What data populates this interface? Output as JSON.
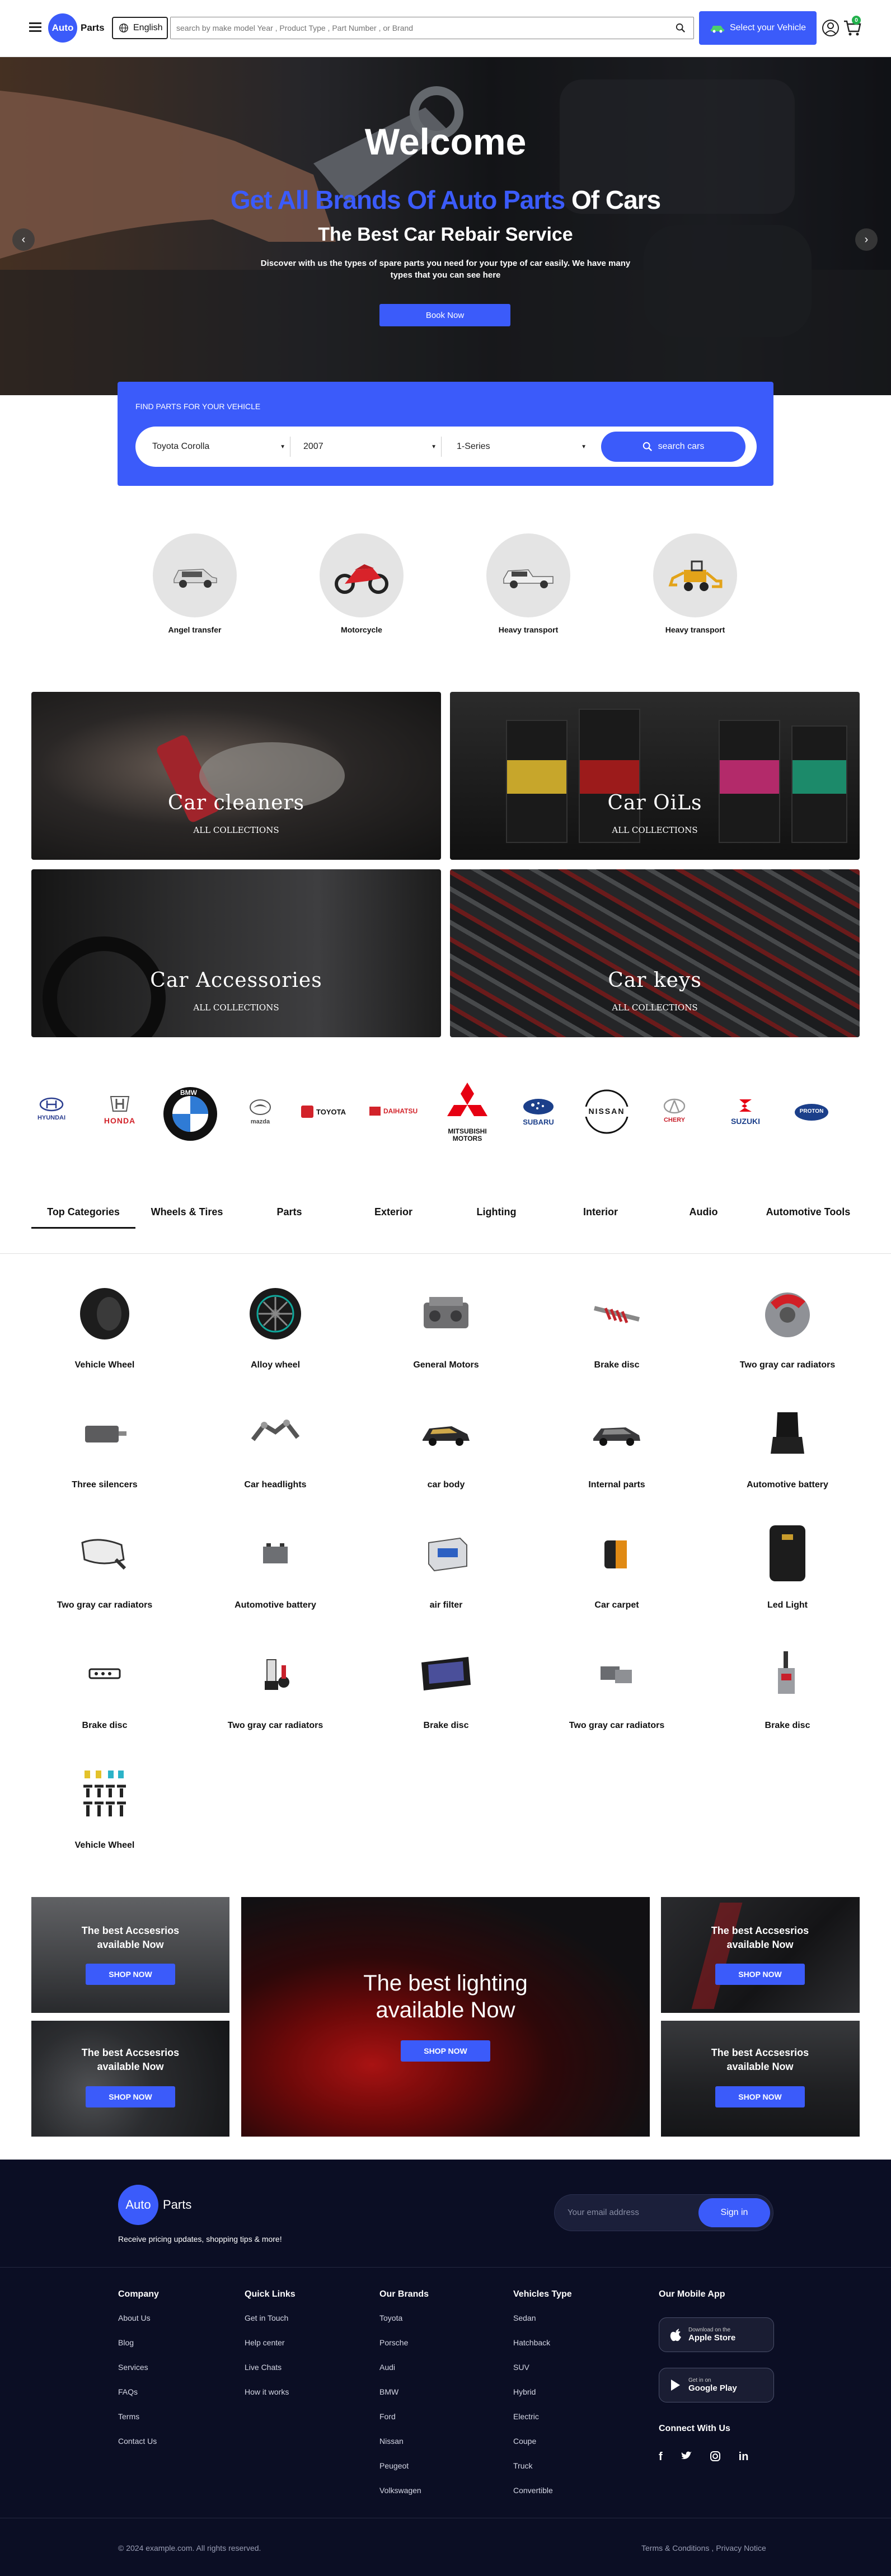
{
  "header": {
    "menu_icon": "hamburger-icon",
    "logo": {
      "part1": "Auto",
      "part2": "Parts"
    },
    "language": "English",
    "search_placeholder": "search by make model Year , Product Type , Part Number , or Brand",
    "select_vehicle": "Select your Vehicle",
    "cart_count": "0"
  },
  "hero": {
    "welcome": "Welcome",
    "headline_blue": "Get All Brands Of Auto Parts",
    "headline_white": "Of Cars",
    "subheading": "The Best Car Rebair Service",
    "description": "Discover with us the types of spare parts you need for your type of car easily. We have many types that you can see here",
    "button": "Book Now",
    "colors": {
      "accent": "#3b5bfa"
    }
  },
  "finder": {
    "title": "FIND PARTS FOR YOUR VEHICLE",
    "model": "Toyota Corolla",
    "year": "2007",
    "series": "1-Series",
    "button": "search cars"
  },
  "vehicle_types": [
    {
      "label": "Angel transfer",
      "icon": "suv-icon"
    },
    {
      "label": "Motorcycle",
      "icon": "motorcycle-icon"
    },
    {
      "label": "Heavy transport",
      "icon": "pickup-truck-icon"
    },
    {
      "label": "Heavy transport",
      "icon": "loader-icon"
    }
  ],
  "collections": [
    {
      "title": "Car cleaners",
      "sub": "ALL COLLECTIONS"
    },
    {
      "title": "Car OiLs",
      "sub": "ALL COLLECTIONS"
    },
    {
      "title": "Car Accessories",
      "sub": "ALL COLLECTIONS"
    },
    {
      "title": "Car keys",
      "sub": "ALL COLLECTIONS"
    }
  ],
  "brands": [
    "HYUNDAI",
    "HONDA",
    "BMW",
    "mazda",
    "TOYOTA",
    "DAIHATSU",
    "MITSUBISHI MOTORS",
    "SUBARU",
    "NISSAN",
    "CHERY",
    "SUZUKI",
    "PROTON"
  ],
  "tabs": [
    "Top Categories",
    "Wheels & Tires",
    "Parts",
    "Exterior",
    "Lighting",
    "Interior",
    "Audio",
    "Automotive Tools"
  ],
  "categories": [
    "Vehicle Wheel",
    "Alloy wheel",
    "General Motors",
    "Brake disc",
    "Two gray car radiators",
    "Three silencers",
    "Car headlights",
    "car body",
    "Internal parts",
    "Automotive battery",
    "Two gray car radiators",
    "Automotive battery",
    "air filter",
    "Car carpet",
    "Led Light",
    "Brake disc",
    "Two gray car radiators",
    "Brake disc",
    "Two gray car radiators",
    "Brake disc",
    "Vehicle Wheel"
  ],
  "promos": {
    "small": "The best Accsesrios available Now",
    "big": "The best lighting available Now",
    "shop": "SHOP NOW"
  },
  "footer": {
    "tagline": "Receive pricing updates, shopping tips & more!",
    "email_placeholder": "Your email address",
    "signin": "Sign in",
    "company": {
      "title": "Company",
      "items": [
        "About Us",
        "Blog",
        "Services",
        "FAQs",
        "Terms",
        "Contact Us"
      ]
    },
    "quick": {
      "title": "Quick Links",
      "items": [
        "Get in Touch",
        "Help center",
        "Live Chats",
        "How it works"
      ]
    },
    "brands": {
      "title": "Our Brands",
      "items": [
        "Toyota",
        "Porsche",
        "Audi",
        "BMW",
        "Ford",
        "Nissan",
        "Peugeot",
        "Volkswagen"
      ]
    },
    "vehicles": {
      "title": "Vehicles Type",
      "items": [
        "Sedan",
        "Hatchback",
        "SUV",
        "Hybrid",
        "Electric",
        "Coupe",
        "Truck",
        "Convertible"
      ]
    },
    "app": {
      "title": "Our Mobile App",
      "apple_small": "Download on the",
      "apple": "Apple Store",
      "google_small": "Get in on",
      "google": "Google Play"
    },
    "connect": "Connect With Us",
    "copyright": "© 2024 example.com. All rights reserved.",
    "terms": "Terms & Conditions",
    "privacy": "Privacy Notice"
  }
}
